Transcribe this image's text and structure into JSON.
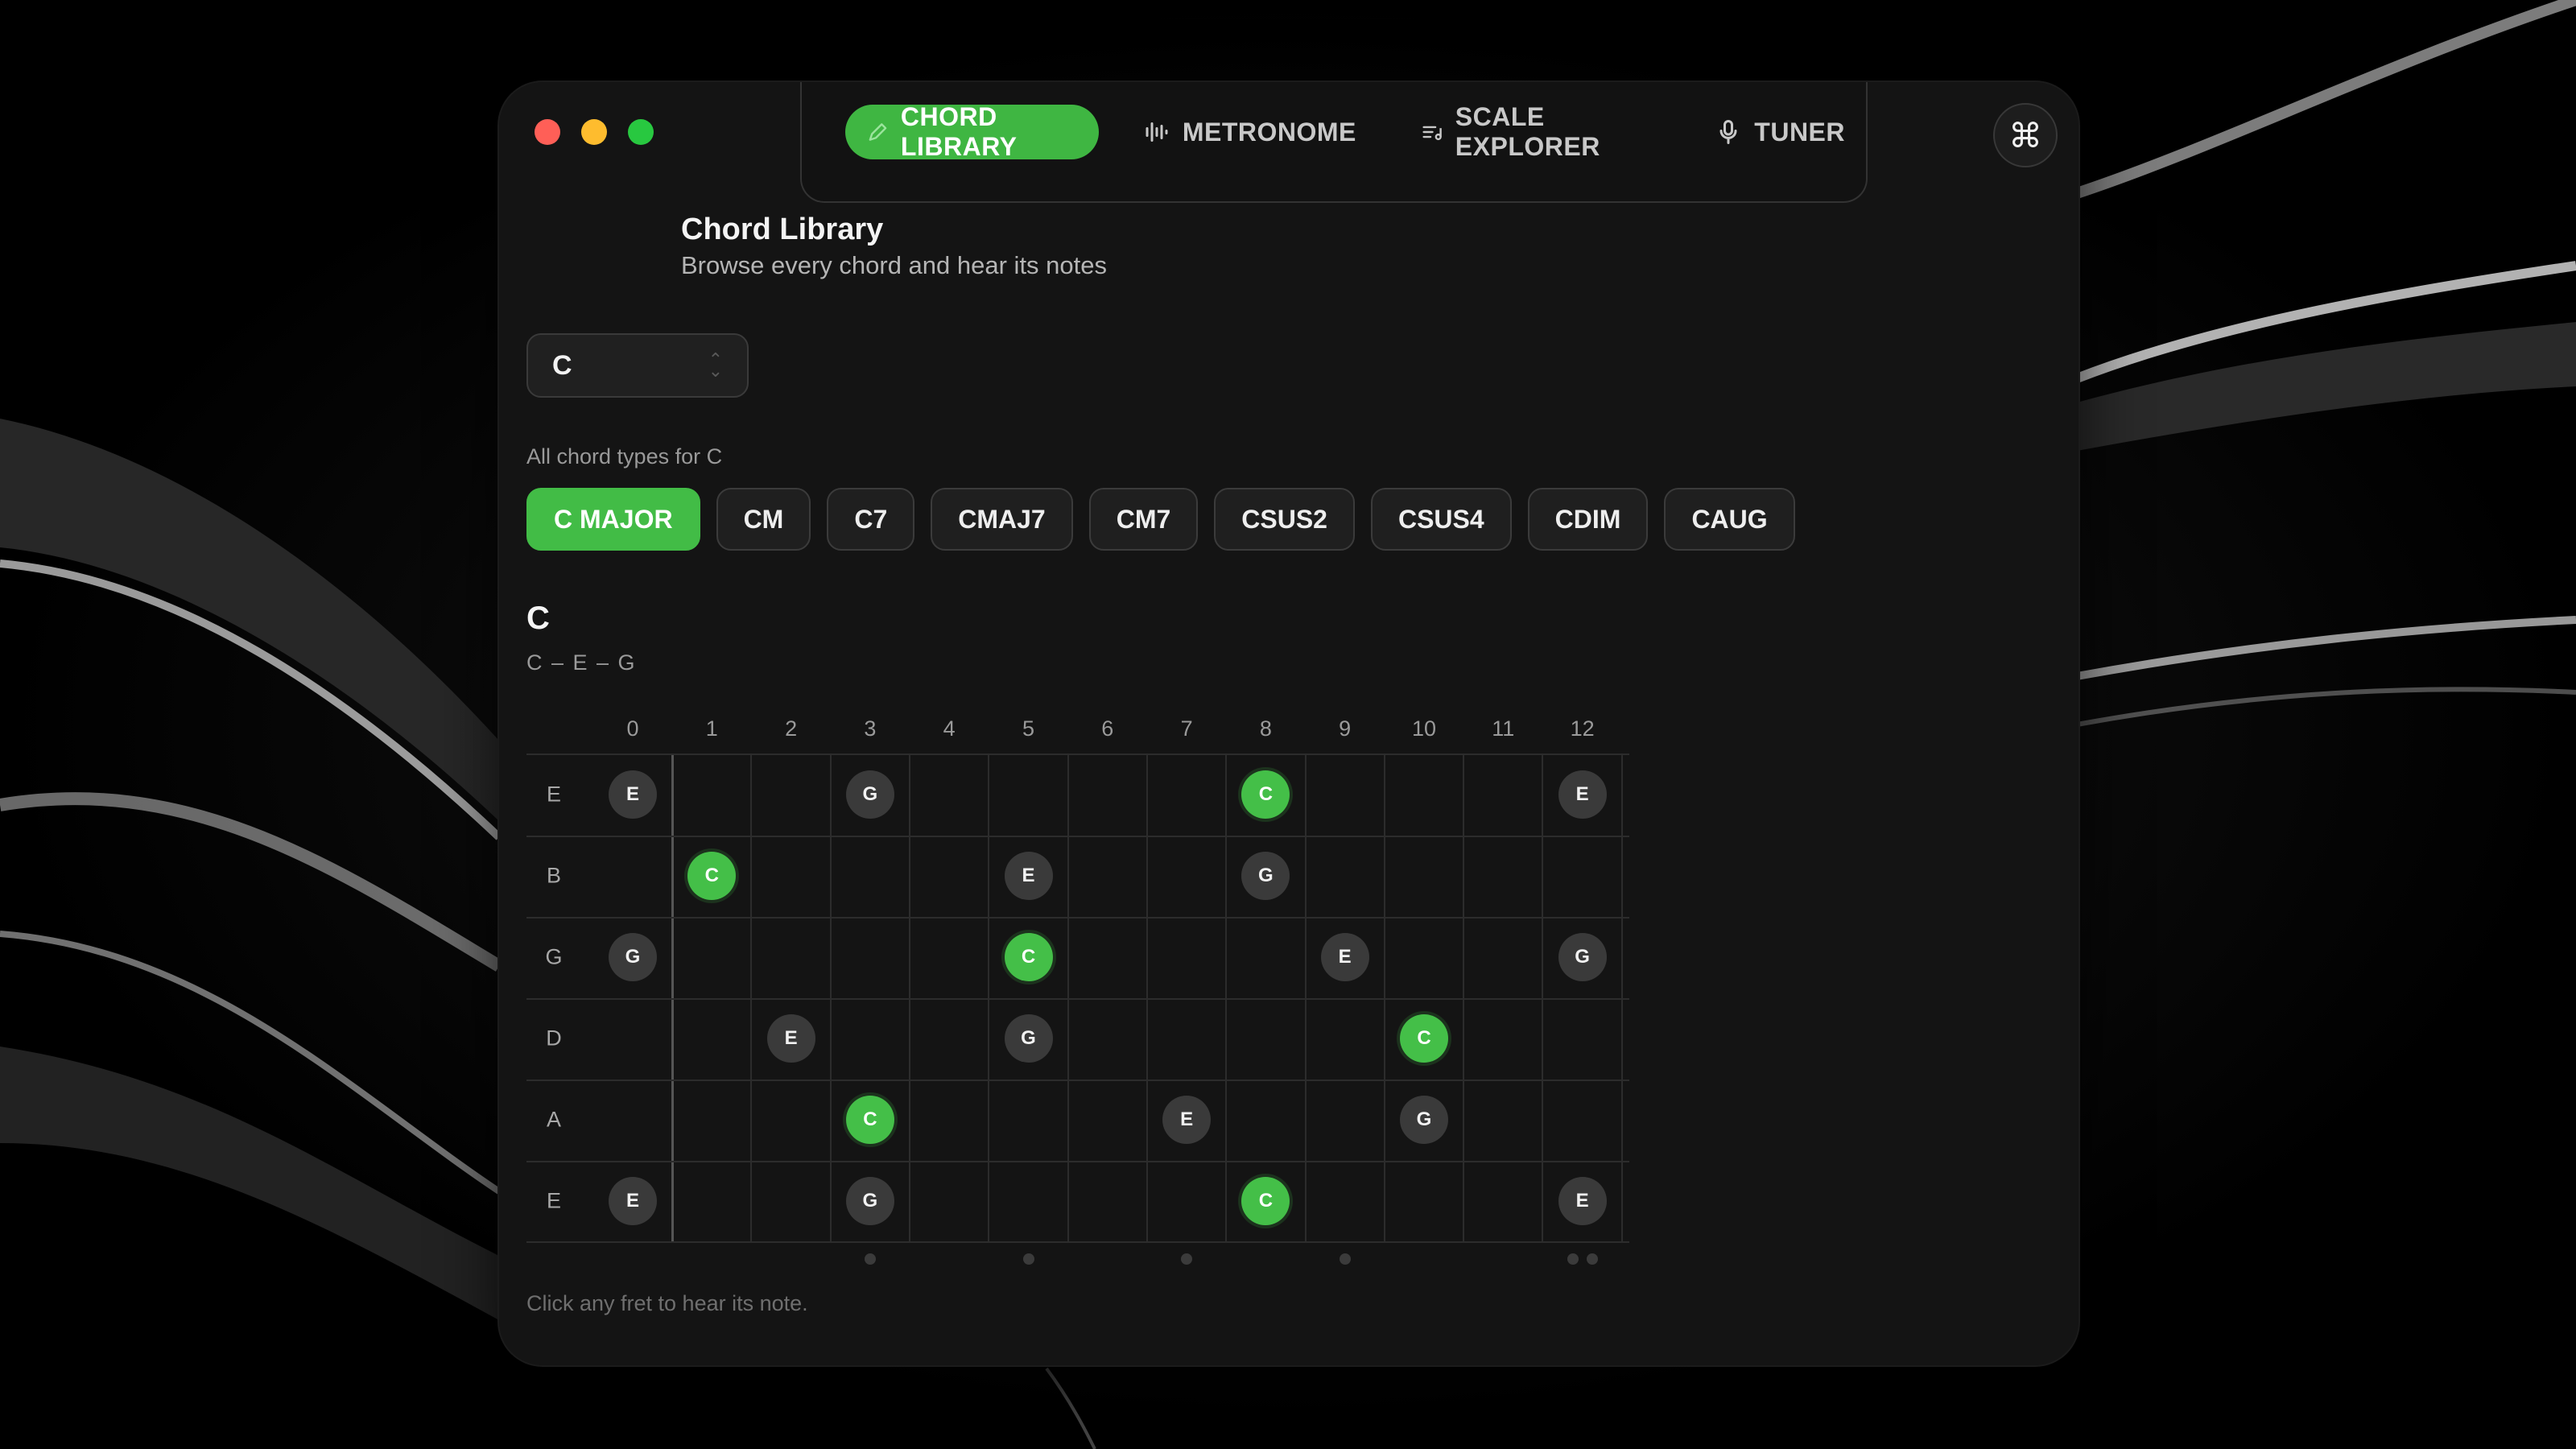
{
  "nav": {
    "tabs": [
      {
        "label": "CHORD LIBRARY",
        "icon": "pencil-icon",
        "active": true
      },
      {
        "label": "METRONOME",
        "icon": "waveform-icon",
        "active": false
      },
      {
        "label": "SCALE EXPLORER",
        "icon": "list-music-icon",
        "active": false
      },
      {
        "label": "TUNER",
        "icon": "microphone-icon",
        "active": false
      }
    ],
    "command_glyph": "⌘"
  },
  "header": {
    "title": "Chord Library",
    "subtitle": "Browse every chord and hear its notes"
  },
  "root_select": {
    "value": "C"
  },
  "types": {
    "label": "All chord types for C",
    "chips": [
      "C MAJOR",
      "CM",
      "C7",
      "CMAJ7",
      "CM7",
      "CSUS2",
      "CSUS4",
      "CDIM",
      "CAUG"
    ],
    "active_index": 0
  },
  "chord": {
    "name": "C",
    "notes": "C – E – G"
  },
  "fretboard": {
    "fret_numbers": [
      "0",
      "1",
      "2",
      "3",
      "4",
      "5",
      "6",
      "7",
      "8",
      "9",
      "10",
      "11",
      "12"
    ],
    "strings": [
      "E",
      "B",
      "G",
      "D",
      "A",
      "E"
    ],
    "notes": [
      {
        "string": 0,
        "fret": 0,
        "label": "E",
        "root": false
      },
      {
        "string": 0,
        "fret": 3,
        "label": "G",
        "root": false
      },
      {
        "string": 0,
        "fret": 8,
        "label": "C",
        "root": true
      },
      {
        "string": 0,
        "fret": 12,
        "label": "E",
        "root": false
      },
      {
        "string": 1,
        "fret": 1,
        "label": "C",
        "root": true
      },
      {
        "string": 1,
        "fret": 5,
        "label": "E",
        "root": false
      },
      {
        "string": 1,
        "fret": 8,
        "label": "G",
        "root": false
      },
      {
        "string": 2,
        "fret": 0,
        "label": "G",
        "root": false
      },
      {
        "string": 2,
        "fret": 5,
        "label": "C",
        "root": true
      },
      {
        "string": 2,
        "fret": 9,
        "label": "E",
        "root": false
      },
      {
        "string": 2,
        "fret": 12,
        "label": "G",
        "root": false
      },
      {
        "string": 3,
        "fret": 2,
        "label": "E",
        "root": false
      },
      {
        "string": 3,
        "fret": 5,
        "label": "G",
        "root": false
      },
      {
        "string": 3,
        "fret": 10,
        "label": "C",
        "root": true
      },
      {
        "string": 4,
        "fret": 3,
        "label": "C",
        "root": true
      },
      {
        "string": 4,
        "fret": 7,
        "label": "E",
        "root": false
      },
      {
        "string": 4,
        "fret": 10,
        "label": "G",
        "root": false
      },
      {
        "string": 5,
        "fret": 0,
        "label": "E",
        "root": false
      },
      {
        "string": 5,
        "fret": 3,
        "label": "G",
        "root": false
      },
      {
        "string": 5,
        "fret": 8,
        "label": "C",
        "root": true
      },
      {
        "string": 5,
        "fret": 12,
        "label": "E",
        "root": false
      }
    ],
    "inlay_frets": [
      3,
      5,
      7,
      9,
      12
    ]
  },
  "hint": "Click any fret to hear its note."
}
